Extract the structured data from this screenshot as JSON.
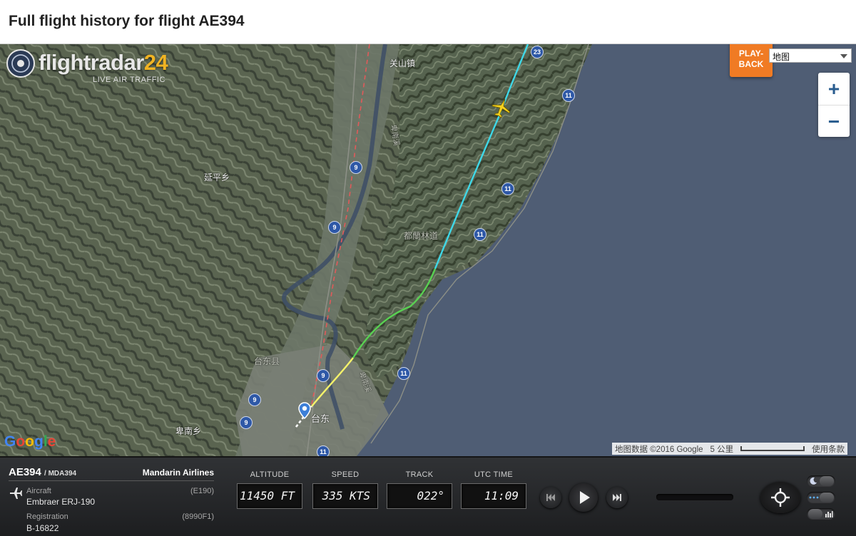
{
  "page": {
    "title": "Full flight history for flight AE394"
  },
  "logo": {
    "brand_name": "flightradar",
    "brand_number": "24",
    "tagline": "LIVE AIR TRAFFIC"
  },
  "map_controls": {
    "playback_line1": "PLAY-",
    "playback_line2": "BACK",
    "map_type": "地图",
    "zoom_in": "+",
    "zoom_out": "−"
  },
  "map_labels": {
    "town_north": "关山镇",
    "township_yanping": "延平乡",
    "forest_road": "都蘭林道",
    "county": "台东县",
    "city": "台东",
    "township_beinan": "卑南乡",
    "river_1": "卑南溪",
    "river_2": "卑南溪"
  },
  "road_shields": [
    "23",
    "11",
    "9",
    "11",
    "9",
    "11",
    "9",
    "11",
    "9",
    "9",
    "11"
  ],
  "attribution": {
    "google": "Google",
    "map_data": "地图数据 ©2016 Google",
    "scale": "5 公里",
    "terms": "使用条款"
  },
  "flight": {
    "id": "AE394",
    "callsign": "/ MDA394",
    "airline": "Mandarin Airlines",
    "aircraft_label": "Aircraft",
    "aircraft_value": "Embraer ERJ-190",
    "aircraft_code": "(E190)",
    "registration_label": "Registration",
    "registration_value": "B-16822",
    "registration_code": "(8990F1)"
  },
  "gauges": {
    "altitude_label": "ALTITUDE",
    "altitude_value": "11450 FT",
    "speed_label": "SPEED",
    "speed_value": "335 KTS",
    "track_label": "TRACK",
    "track_value": "022°",
    "time_label": "UTC TIME",
    "time_value": "11:09"
  },
  "colors": {
    "accent_orange": "#f07b24",
    "trail_low": "#f4f26a",
    "trail_mid": "#59d152",
    "trail_high": "#3fd8e8",
    "plane": "#f6d21f",
    "route_dashed": "#e05a5a"
  }
}
